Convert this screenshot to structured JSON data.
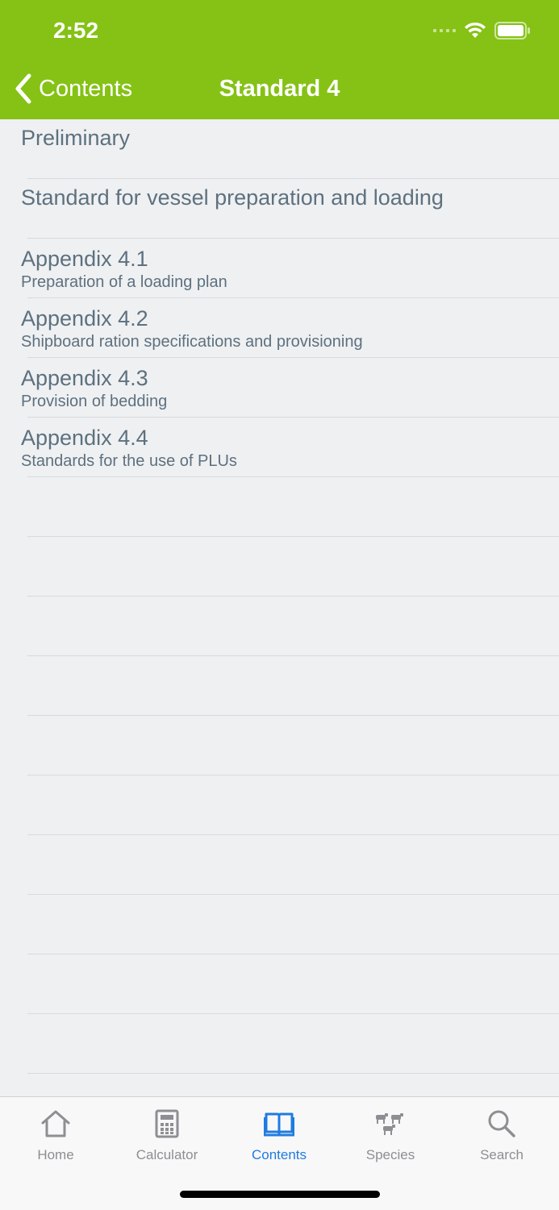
{
  "status_bar": {
    "time": "2:52"
  },
  "nav": {
    "back_label": "Contents",
    "title": "Standard 4"
  },
  "list": {
    "items": [
      {
        "title": "Preliminary"
      },
      {
        "title": "Standard for vessel preparation and loading"
      },
      {
        "title": "Appendix 4.1",
        "subtitle": "Preparation of a loading plan"
      },
      {
        "title": "Appendix 4.2",
        "subtitle": "Shipboard ration specifications and provisioning"
      },
      {
        "title": "Appendix 4.3",
        "subtitle": "Provision of bedding"
      },
      {
        "title": "Appendix 4.4",
        "subtitle": "Standards for the use of PLUs"
      }
    ]
  },
  "tabbar": {
    "tabs": [
      {
        "label": "Home",
        "icon": "home-icon",
        "active": false
      },
      {
        "label": "Calculator",
        "icon": "calculator-icon",
        "active": false
      },
      {
        "label": "Contents",
        "icon": "book-icon",
        "active": true
      },
      {
        "label": "Species",
        "icon": "livestock-icon",
        "active": false
      },
      {
        "label": "Search",
        "icon": "search-icon",
        "active": false
      }
    ]
  },
  "colors": {
    "header": "#85c215",
    "active_tab": "#1f7be1",
    "inactive_tab": "#8e8e93",
    "list_text": "#5d717f",
    "background": "#eff0f2"
  }
}
